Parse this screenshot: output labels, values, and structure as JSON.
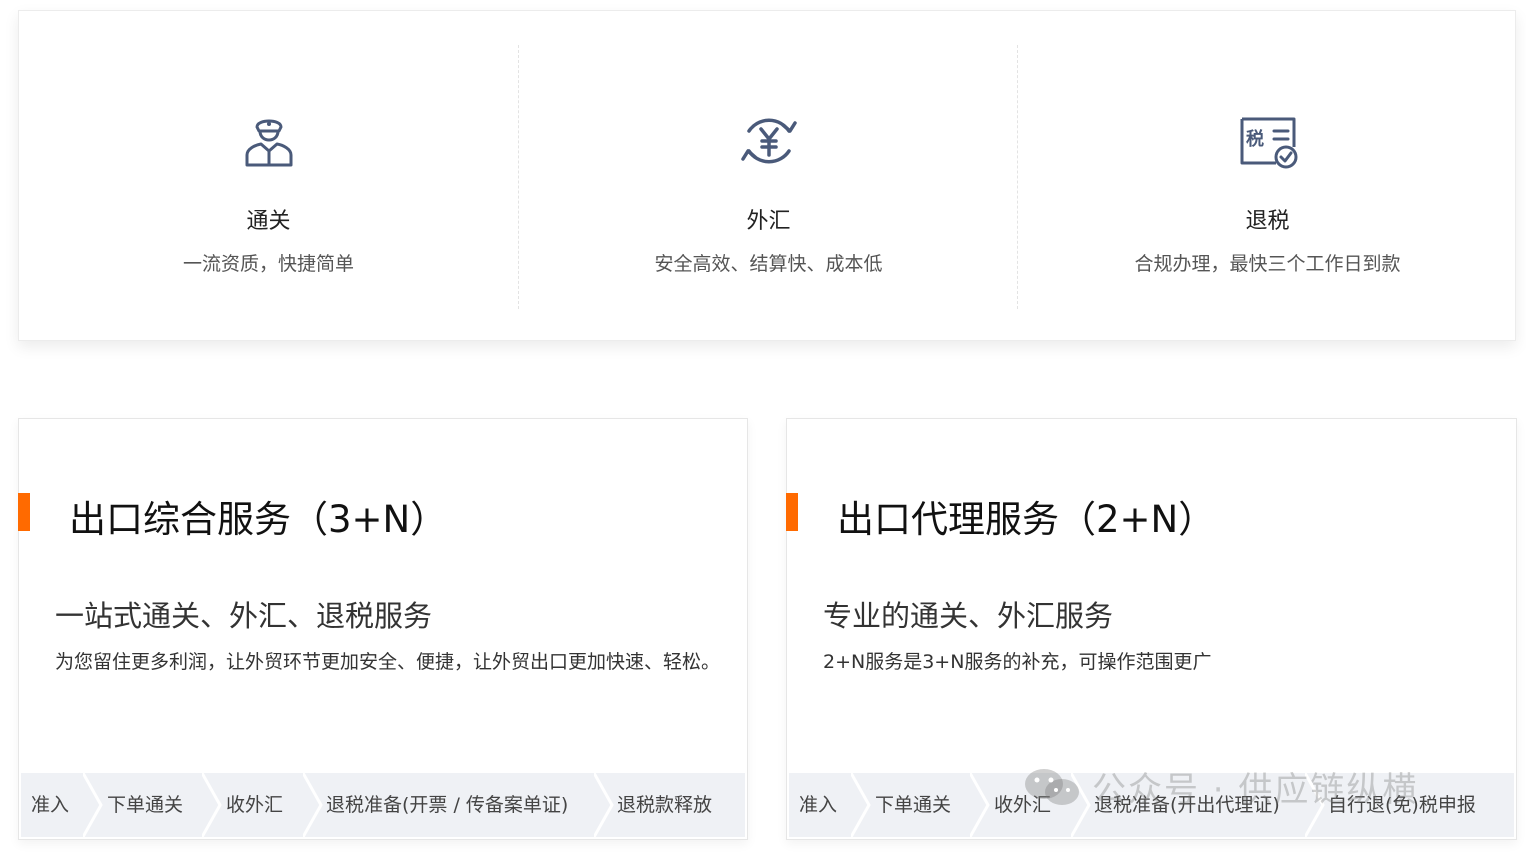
{
  "features": [
    {
      "icon": "customs-officer-icon",
      "title": "通关",
      "desc": "一流资质，快捷简单"
    },
    {
      "icon": "yuan-exchange-icon",
      "title": "外汇",
      "desc": "安全高效、结算快、成本低"
    },
    {
      "icon": "tax-certificate-icon",
      "title": "退税",
      "desc": "合规办理，最快三个工作日到款"
    }
  ],
  "services": [
    {
      "title": "出口综合服务（3+N）",
      "subtitle": "一站式通关、外汇、退税服务",
      "desc": "为您留住更多利润，让外贸环节更加安全、便捷，让外贸出口更加快速、轻松。",
      "steps": [
        "准入",
        "下单通关",
        "收外汇",
        "退税准备(开票 / 传备案单证)",
        "退税款释放"
      ]
    },
    {
      "title": "出口代理服务（2+N）",
      "subtitle": "专业的通关、外汇服务",
      "desc": "2+N服务是3+N服务的补充，可操作范围更广",
      "steps": [
        "准入",
        "下单通关",
        "收外汇",
        "退税准备(开出代理证)",
        "自行退(免)税申报"
      ]
    }
  ],
  "watermark": {
    "text": "公众号 · 供应链纵横"
  },
  "colors": {
    "accent": "#ff6a00",
    "icon": "#4a5a7a",
    "step_bg": "#eff1f5"
  }
}
